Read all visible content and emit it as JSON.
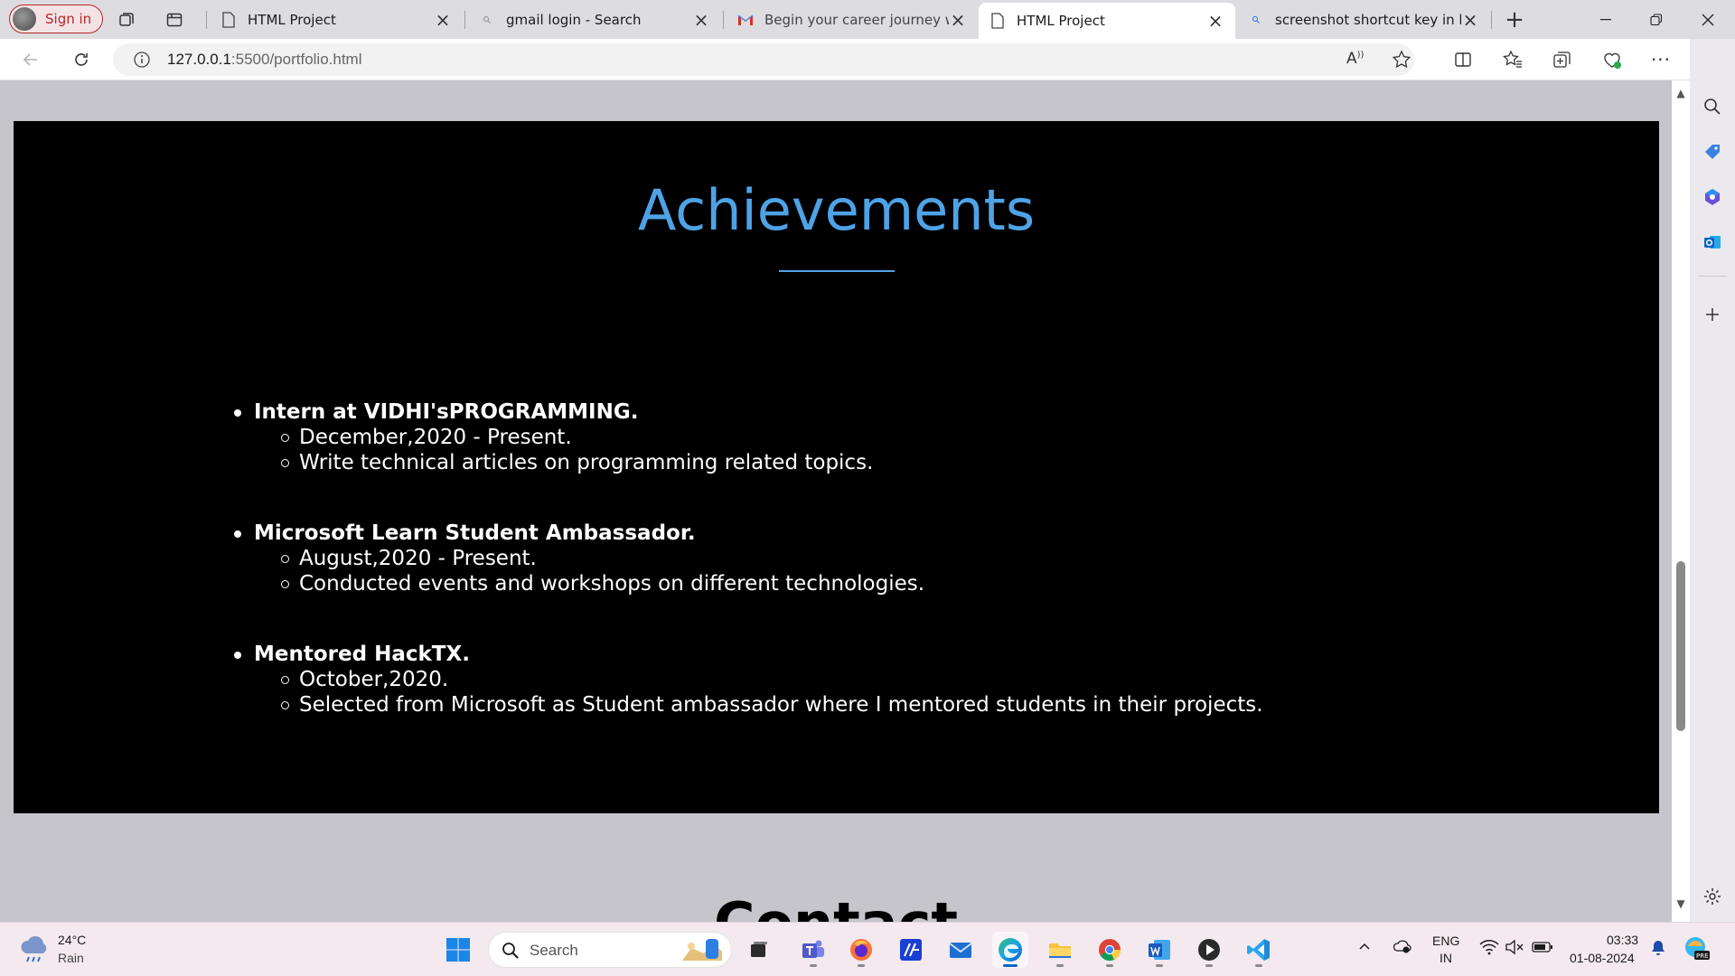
{
  "browser": {
    "signin_label": "Sign in",
    "tabs": [
      {
        "title": "HTML Project",
        "icon": "page-icon"
      },
      {
        "title": "gmail login - Search",
        "icon": "search-icon"
      },
      {
        "title": "Begin your career journey with",
        "icon": "gmail-icon"
      },
      {
        "title": "HTML Project",
        "icon": "page-icon",
        "active": true
      },
      {
        "title": "screenshot shortcut key in lapt",
        "icon": "search-icon"
      }
    ],
    "new_tab_label": "+",
    "url_host": "127.0.0.1",
    "url_rest": ":5500/portfolio.html",
    "read_aloud_label": "A"
  },
  "page": {
    "achievements_title": "Achievements",
    "achievements": [
      {
        "heading": "Intern at VIDHI'sPROGRAMMING.",
        "details": [
          "December,2020 - Present.",
          "Write technical articles on programming related topics."
        ]
      },
      {
        "heading": "Microsoft Learn Student Ambassador.",
        "details": [
          "August,2020 - Present.",
          "Conducted events and workshops on different technologies."
        ]
      },
      {
        "heading": "Mentored HackTX.",
        "details": [
          "October,2020.",
          "Selected from Microsoft as Student ambassador where I mentored students in their projects."
        ]
      }
    ],
    "contact_title": "Contact"
  },
  "taskbar": {
    "weather_temp": "24°C",
    "weather_desc": "Rain",
    "search_label": "Search",
    "lang_line1": "ENG",
    "lang_line2": "IN",
    "time": "03:33",
    "date": "01-08-2024"
  },
  "colors": {
    "accent": "#4ea3e6",
    "section_bg": "#000000",
    "page_bg": "#c6c5cb",
    "signin_red": "#b5272d"
  }
}
